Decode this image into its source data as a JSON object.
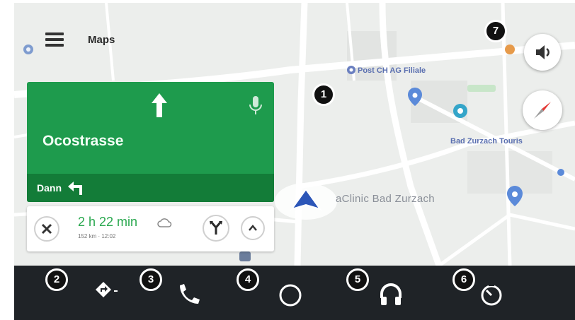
{
  "app": {
    "title": "Maps"
  },
  "map": {
    "labels": [
      {
        "text": "Post CH AG Filiale",
        "style": "normal"
      },
      {
        "text": "Bad Zurzach Touris",
        "style": "normal"
      },
      {
        "text": "aClinic Bad Zurzach",
        "style": "big"
      }
    ]
  },
  "navigation": {
    "street": "Ocostrasse",
    "next_instruction_label": "Dann",
    "eta": "2 h 22 min",
    "eta_details": "152 km · 12:02"
  },
  "callouts": [
    "1",
    "2",
    "3",
    "4",
    "5",
    "6",
    "7"
  ],
  "dock": {
    "items": [
      "navigation-icon",
      "phone-icon",
      "home-circle-icon",
      "headphones-icon",
      "dashboard-icon"
    ]
  },
  "colors": {
    "nav_green": "#1e9b4d",
    "nav_dark_green": "#137c38",
    "eta_green": "#2aa84f",
    "dock_bg": "#1f2327",
    "position_arrow": "#2c56b8"
  }
}
